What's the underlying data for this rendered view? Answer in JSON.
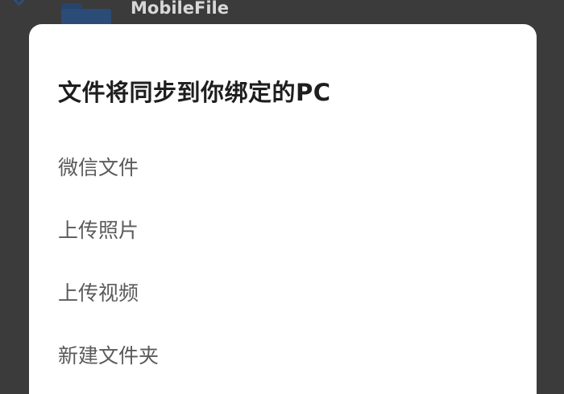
{
  "background": {
    "file_name": "MobileFile",
    "folder_icon": "folder-icon",
    "back_icon": "chevron-left-icon"
  },
  "dialog": {
    "title": "文件将同步到你绑定的PC",
    "items": [
      {
        "label": "微信文件"
      },
      {
        "label": "上传照片"
      },
      {
        "label": "上传视频"
      },
      {
        "label": "新建文件夹"
      }
    ]
  },
  "colors": {
    "scrim": "#3b3b3b",
    "dialog_bg": "#ffffff",
    "title_text": "#1e1e1e",
    "item_text": "#5a5a5a",
    "folder": "#2b4c76"
  }
}
